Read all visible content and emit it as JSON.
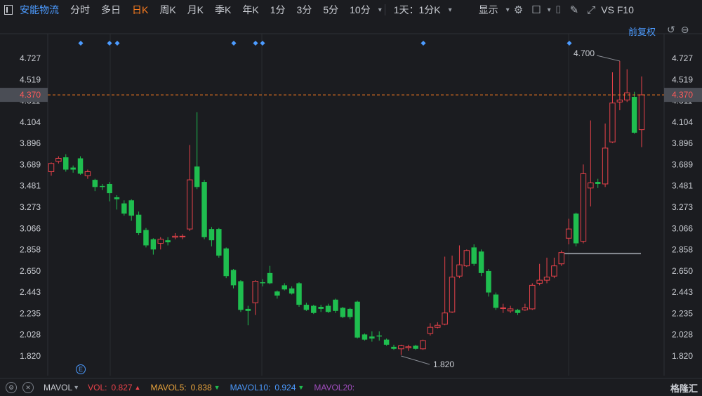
{
  "toolbar": {
    "stock_name": "安能物流",
    "periods": [
      "分时",
      "多日",
      "日K",
      "周K",
      "月K",
      "季K",
      "年K",
      "1分",
      "3分",
      "5分",
      "10分"
    ],
    "active_period": "日K",
    "range_selector": "1天：1分K",
    "display_label": "显示",
    "right_text": "VS F10"
  },
  "header": {
    "adjust_label": "前复权"
  },
  "event_marker_label": "E",
  "colors": {
    "up": "#e8424a",
    "down": "#1fbe4f",
    "accent": "#4c9bff",
    "current_price_line": "#ff7e1f",
    "axis_text": "#c9ccd2",
    "grid": "#2a2c31"
  },
  "chart_data": {
    "type": "candlestick",
    "y_ticks": [
      "4.727",
      "4.519",
      "4.311",
      "4.104",
      "3.896",
      "3.689",
      "3.481",
      "3.273",
      "3.066",
      "2.858",
      "2.650",
      "2.443",
      "2.235",
      "2.028",
      "1.820"
    ],
    "y_tick_values": [
      4.727,
      4.519,
      4.311,
      4.104,
      3.896,
      3.689,
      3.481,
      3.273,
      3.066,
      2.858,
      2.65,
      2.443,
      2.235,
      2.028,
      1.82
    ],
    "ylim": [
      1.72,
      4.86
    ],
    "current_price": "4.370",
    "current_price_value": 4.37,
    "high_annotation": "4.700",
    "high_value": 4.7,
    "low_annotation": "1.820",
    "low_value": 1.82,
    "support_level": 2.82,
    "candles": [
      {
        "o": 3.62,
        "c": 3.7,
        "h": 3.71,
        "l": 3.58
      },
      {
        "o": 3.72,
        "c": 3.75,
        "h": 3.77,
        "l": 3.7
      },
      {
        "o": 3.76,
        "c": 3.64,
        "h": 3.79,
        "l": 3.62
      },
      {
        "o": 3.66,
        "c": 3.64,
        "h": 3.68,
        "l": 3.61
      },
      {
        "o": 3.75,
        "c": 3.6,
        "h": 3.77,
        "l": 3.59
      },
      {
        "o": 3.58,
        "c": 3.62,
        "h": 3.64,
        "l": 3.55
      },
      {
        "o": 3.54,
        "c": 3.47,
        "h": 3.55,
        "l": 3.43
      },
      {
        "o": 3.48,
        "c": 3.47,
        "h": 3.5,
        "l": 3.44
      },
      {
        "o": 3.5,
        "c": 3.41,
        "h": 3.52,
        "l": 3.33
      },
      {
        "o": 3.37,
        "c": 3.35,
        "h": 3.39,
        "l": 3.25
      },
      {
        "o": 3.31,
        "c": 3.21,
        "h": 3.34,
        "l": 3.19
      },
      {
        "o": 3.34,
        "c": 3.19,
        "h": 3.35,
        "l": 3.14
      },
      {
        "o": 3.2,
        "c": 3.02,
        "h": 3.23,
        "l": 3.0
      },
      {
        "o": 3.05,
        "c": 2.9,
        "h": 3.07,
        "l": 2.88
      },
      {
        "o": 2.96,
        "c": 2.86,
        "h": 2.97,
        "l": 2.81
      },
      {
        "o": 2.92,
        "c": 2.96,
        "h": 2.98,
        "l": 2.86
      },
      {
        "o": 2.95,
        "c": 2.93,
        "h": 2.98,
        "l": 2.9
      },
      {
        "o": 2.98,
        "c": 2.99,
        "h": 3.02,
        "l": 2.96
      },
      {
        "o": 2.99,
        "c": 2.99,
        "h": 3.01,
        "l": 2.96
      },
      {
        "o": 3.06,
        "c": 3.54,
        "h": 3.88,
        "l": 3.04
      },
      {
        "o": 3.67,
        "c": 3.47,
        "h": 4.2,
        "l": 3.45
      },
      {
        "o": 3.52,
        "c": 2.98,
        "h": 3.54,
        "l": 2.96
      },
      {
        "o": 3.06,
        "c": 2.95,
        "h": 3.08,
        "l": 2.89
      },
      {
        "o": 3.06,
        "c": 2.8,
        "h": 3.07,
        "l": 2.78
      },
      {
        "o": 2.87,
        "c": 2.6,
        "h": 2.88,
        "l": 2.58
      },
      {
        "o": 2.66,
        "c": 2.51,
        "h": 2.67,
        "l": 2.48
      },
      {
        "o": 2.55,
        "c": 2.27,
        "h": 2.56,
        "l": 2.25
      },
      {
        "o": 2.28,
        "c": 2.26,
        "h": 2.31,
        "l": 2.12
      },
      {
        "o": 2.34,
        "c": 2.55,
        "h": 2.56,
        "l": 2.22
      },
      {
        "o": 2.54,
        "c": 2.53,
        "h": 2.57,
        "l": 2.5
      },
      {
        "o": 2.63,
        "c": 2.53,
        "h": 2.7,
        "l": 2.52
      },
      {
        "o": 2.45,
        "c": 2.41,
        "h": 2.46,
        "l": 2.38
      },
      {
        "o": 2.51,
        "c": 2.47,
        "h": 2.53,
        "l": 2.46
      },
      {
        "o": 2.48,
        "c": 2.43,
        "h": 2.5,
        "l": 2.42
      },
      {
        "o": 2.53,
        "c": 2.32,
        "h": 2.54,
        "l": 2.3
      },
      {
        "o": 2.32,
        "c": 2.27,
        "h": 2.34,
        "l": 2.26
      },
      {
        "o": 2.31,
        "c": 2.24,
        "h": 2.32,
        "l": 2.23
      },
      {
        "o": 2.3,
        "c": 2.28,
        "h": 2.32,
        "l": 2.25
      },
      {
        "o": 2.31,
        "c": 2.25,
        "h": 2.33,
        "l": 2.24
      },
      {
        "o": 2.37,
        "c": 2.26,
        "h": 2.38,
        "l": 2.24
      },
      {
        "o": 2.29,
        "c": 2.2,
        "h": 2.3,
        "l": 2.19
      },
      {
        "o": 2.28,
        "c": 2.2,
        "h": 2.29,
        "l": 2.18
      },
      {
        "o": 2.35,
        "c": 2.0,
        "h": 2.36,
        "l": 1.99
      },
      {
        "o": 2.03,
        "c": 1.98,
        "h": 2.04,
        "l": 1.97
      },
      {
        "o": 2.01,
        "c": 1.99,
        "h": 2.06,
        "l": 1.96
      },
      {
        "o": 2.02,
        "c": 2.01,
        "h": 2.06,
        "l": 1.97
      },
      {
        "o": 1.98,
        "c": 1.93,
        "h": 1.99,
        "l": 1.92
      },
      {
        "o": 1.91,
        "c": 1.89,
        "h": 1.93,
        "l": 1.88
      },
      {
        "o": 1.89,
        "c": 1.92,
        "h": 1.93,
        "l": 1.83
      },
      {
        "o": 1.9,
        "c": 1.91,
        "h": 1.93,
        "l": 1.87
      },
      {
        "o": 1.92,
        "c": 1.89,
        "h": 1.93,
        "l": 1.88
      },
      {
        "o": 1.89,
        "c": 1.97,
        "h": 1.98,
        "l": 1.88
      },
      {
        "o": 2.04,
        "c": 2.1,
        "h": 2.14,
        "l": 2.02
      },
      {
        "o": 2.1,
        "c": 2.12,
        "h": 2.15,
        "l": 2.09
      },
      {
        "o": 2.13,
        "c": 2.24,
        "h": 2.79,
        "l": 2.12
      },
      {
        "o": 2.25,
        "c": 2.59,
        "h": 2.8,
        "l": 2.24
      },
      {
        "o": 2.6,
        "c": 2.71,
        "h": 2.9,
        "l": 2.58
      },
      {
        "o": 2.7,
        "c": 2.85,
        "h": 2.86,
        "l": 2.69
      },
      {
        "o": 2.88,
        "c": 2.72,
        "h": 2.91,
        "l": 2.7
      },
      {
        "o": 2.84,
        "c": 2.63,
        "h": 2.86,
        "l": 2.6
      },
      {
        "o": 2.65,
        "c": 2.44,
        "h": 2.67,
        "l": 2.4
      },
      {
        "o": 2.42,
        "c": 2.29,
        "h": 2.44,
        "l": 2.27
      },
      {
        "o": 2.29,
        "c": 2.29,
        "h": 2.33,
        "l": 2.24
      },
      {
        "o": 2.26,
        "c": 2.28,
        "h": 2.31,
        "l": 2.24
      },
      {
        "o": 2.27,
        "c": 2.24,
        "h": 2.28,
        "l": 2.22
      },
      {
        "o": 2.27,
        "c": 2.29,
        "h": 2.33,
        "l": 2.26
      },
      {
        "o": 2.28,
        "c": 2.51,
        "h": 2.53,
        "l": 2.27
      },
      {
        "o": 2.53,
        "c": 2.56,
        "h": 2.72,
        "l": 2.51
      },
      {
        "o": 2.56,
        "c": 2.59,
        "h": 2.78,
        "l": 2.53
      },
      {
        "o": 2.6,
        "c": 2.7,
        "h": 2.78,
        "l": 2.58
      },
      {
        "o": 2.72,
        "c": 2.83,
        "h": 2.85,
        "l": 2.7
      },
      {
        "o": 2.97,
        "c": 3.06,
        "h": 3.16,
        "l": 2.91
      },
      {
        "o": 3.21,
        "c": 2.92,
        "h": 3.22,
        "l": 2.89
      },
      {
        "o": 2.94,
        "c": 3.6,
        "h": 3.69,
        "l": 2.92
      },
      {
        "o": 3.46,
        "c": 3.51,
        "h": 4.12,
        "l": 3.28
      },
      {
        "o": 3.52,
        "c": 3.5,
        "h": 3.55,
        "l": 3.46
      },
      {
        "o": 3.5,
        "c": 3.85,
        "h": 4.09,
        "l": 3.47
      },
      {
        "o": 3.91,
        "c": 4.29,
        "h": 4.59,
        "l": 3.9
      },
      {
        "o": 4.3,
        "c": 4.32,
        "h": 4.7,
        "l": 4.22
      },
      {
        "o": 4.32,
        "c": 4.39,
        "h": 4.62,
        "l": 4.3
      },
      {
        "o": 4.35,
        "c": 4.0,
        "h": 4.4,
        "l": 3.99
      },
      {
        "o": 4.03,
        "c": 4.37,
        "h": 4.55,
        "l": 3.86
      }
    ],
    "event_marker_indices": [
      3,
      6,
      7,
      18,
      20,
      21,
      40,
      60
    ]
  },
  "indicator_bar": {
    "name": "MAVOL",
    "vol_label": "VOL:",
    "vol_value": "0.827",
    "mavol5_label": "MAVOL5:",
    "mavol5_value": "0.838",
    "mavol10_label": "MAVOL10:",
    "mavol10_value": "0.924",
    "mavol20_label": "MAVOL20:"
  },
  "watermark": "格隆汇"
}
